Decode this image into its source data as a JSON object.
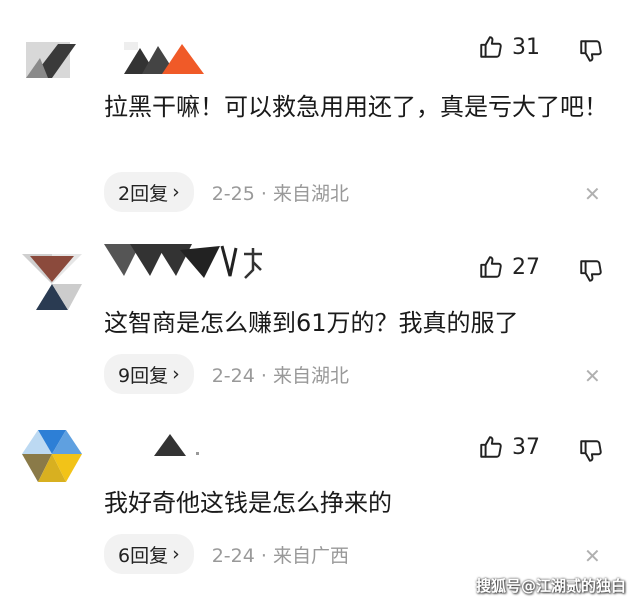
{
  "comments": [
    {
      "likes": "31",
      "text": "拉黑干嘛！可以救急用用还了，真是亏大了吧！",
      "reply_label": "2回复",
      "date": "2-25",
      "location": "来自湖北"
    },
    {
      "likes": "27",
      "text": "这智商是怎么赚到61万的？我真的服了",
      "reply_label": "9回复",
      "date": "2-24",
      "location": "来自湖北"
    },
    {
      "likes": "37",
      "text": "我好奇他这钱是怎么挣来的",
      "reply_label": "6回复",
      "date": "2-24",
      "location": "来自广西"
    }
  ],
  "separator": "·",
  "reply_chevron": "›",
  "close_glyph": "✕",
  "watermark": "搜狐号@江湖贰的独白",
  "icons": {
    "like": "thumbs-up-icon",
    "dislike": "thumbs-down-icon",
    "close": "close-icon",
    "chevron": "chevron-right-icon"
  },
  "colors": {
    "text": "#1a1a1a",
    "meta": "#999999",
    "pill_bg": "#f2f2f2",
    "close": "#b0b0b0",
    "avatar_orange": "#f05a28",
    "avatar_blue": "#2d7fd6",
    "avatar_yellow": "#f2c318"
  }
}
